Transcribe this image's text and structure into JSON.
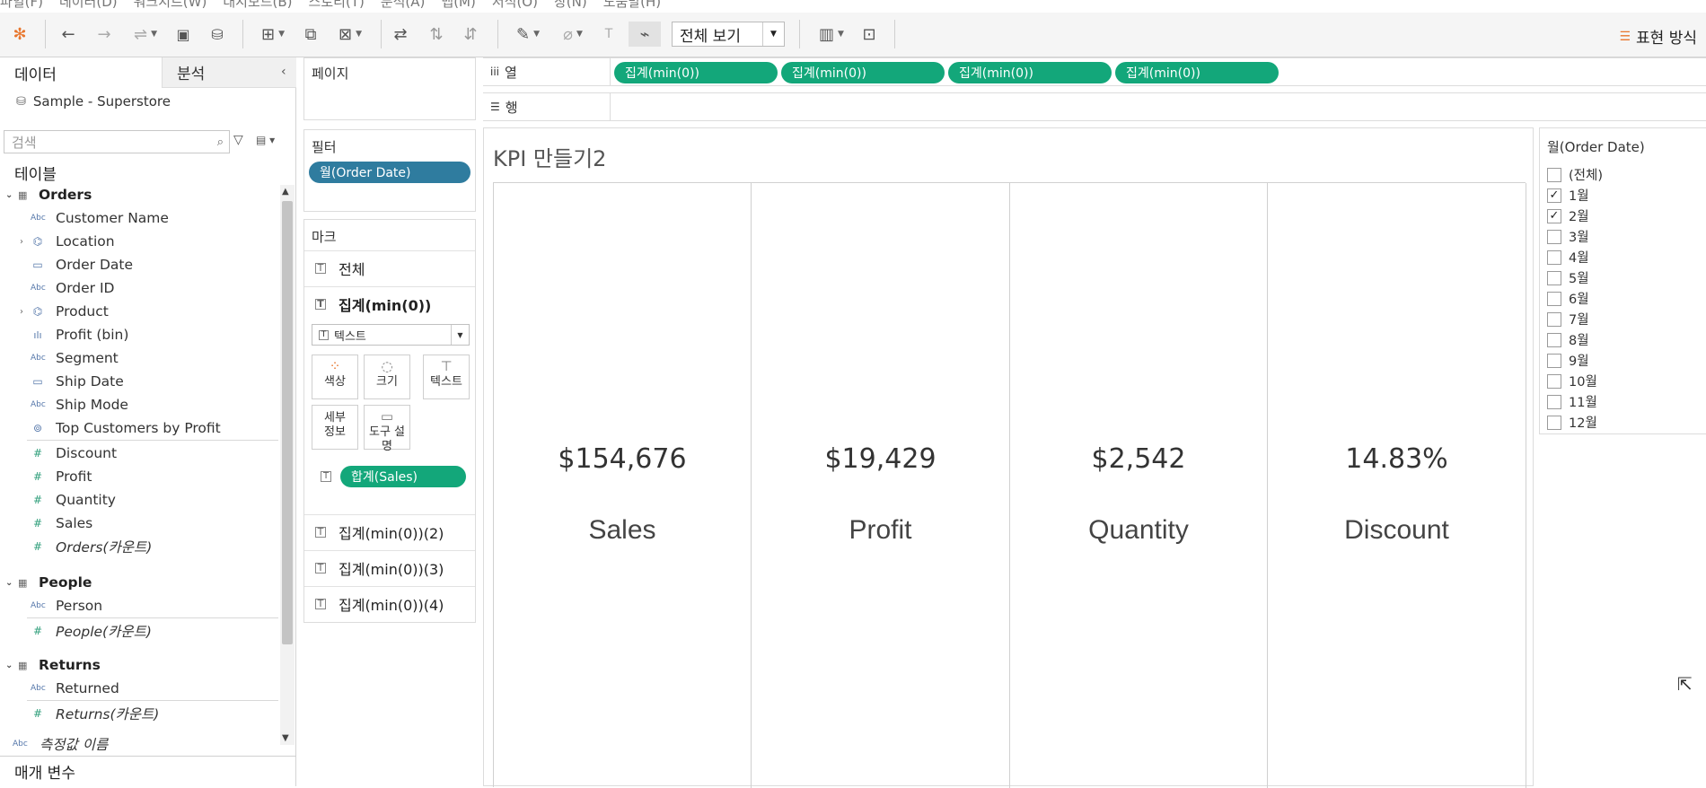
{
  "menu": [
    "파일(F)",
    "데이터(D)",
    "워크시트(W)",
    "대시보드(B)",
    "스토리(T)",
    "분석(A)",
    "맵(M)",
    "서식(O)",
    "창(N)",
    "도움말(H)"
  ],
  "toolbar": {
    "view_select": "전체 보기",
    "show_me": "표현 방식"
  },
  "left_pane": {
    "tab_data": "데이터",
    "tab_analysis": "분석",
    "datasource": "Sample - Superstore",
    "search_placeholder": "검색",
    "tables_label": "테이블",
    "groups": [
      {
        "name": "Orders",
        "fields": [
          "Customer Name",
          "Location",
          "Order Date",
          "Order ID",
          "Product",
          "Profit (bin)",
          "Segment",
          "Ship Date",
          "Ship Mode",
          "Top Customers by Profit"
        ],
        "measures": [
          "Discount",
          "Profit",
          "Quantity",
          "Sales"
        ],
        "count": "Orders(카운트)"
      },
      {
        "name": "People",
        "fields": [
          "Person"
        ],
        "count": "People(카운트)"
      },
      {
        "name": "Returns",
        "fields": [
          "Returned"
        ],
        "count": "Returns(카운트)"
      }
    ],
    "measure_names": "측정값 이름",
    "parameters": "매개 변수"
  },
  "cards": {
    "pages": "페이지",
    "filters": "필터",
    "filter_pill": "월(Order Date)",
    "marks": "마크",
    "marks_all": "전체",
    "marks_active": "집계(min(0))",
    "mark_type": "텍스트",
    "btn_color": "색상",
    "btn_size": "크기",
    "btn_text": "텍스트",
    "btn_detail_1": "세부",
    "btn_detail_2": "정보",
    "btn_tooltip": "도구 설명",
    "marks_pill": "합계(Sales)",
    "marks_2": "집계(min(0))(2)",
    "marks_3": "집계(min(0))(3)",
    "marks_4": "집계(min(0))(4)"
  },
  "shelves": {
    "columns_label": "열",
    "rows_label": "행",
    "column_pills": [
      "집계(min(0))",
      "집계(min(0))",
      "집계(min(0))",
      "집계(min(0))"
    ]
  },
  "viz": {
    "title": "KPI 만들기2",
    "kpis": [
      {
        "value": "$154,676",
        "label": "Sales"
      },
      {
        "value": "$19,429",
        "label": "Profit"
      },
      {
        "value": "$2,542",
        "label": "Quantity"
      },
      {
        "value": "14.83%",
        "label": "Discount"
      }
    ]
  },
  "quick_filter": {
    "title": "월(Order Date)",
    "items": [
      {
        "label": "(전체)",
        "checked": false
      },
      {
        "label": "1월",
        "checked": true
      },
      {
        "label": "2월",
        "checked": true
      },
      {
        "label": "3월",
        "checked": false
      },
      {
        "label": "4월",
        "checked": false
      },
      {
        "label": "5월",
        "checked": false
      },
      {
        "label": "6월",
        "checked": false
      },
      {
        "label": "7월",
        "checked": false
      },
      {
        "label": "8월",
        "checked": false
      },
      {
        "label": "9월",
        "checked": false
      },
      {
        "label": "10월",
        "checked": false
      },
      {
        "label": "11월",
        "checked": false
      },
      {
        "label": "12월",
        "checked": false
      }
    ]
  },
  "colors": {
    "green_pill": "#13a77a",
    "blue_pill": "#2f7c9f"
  }
}
